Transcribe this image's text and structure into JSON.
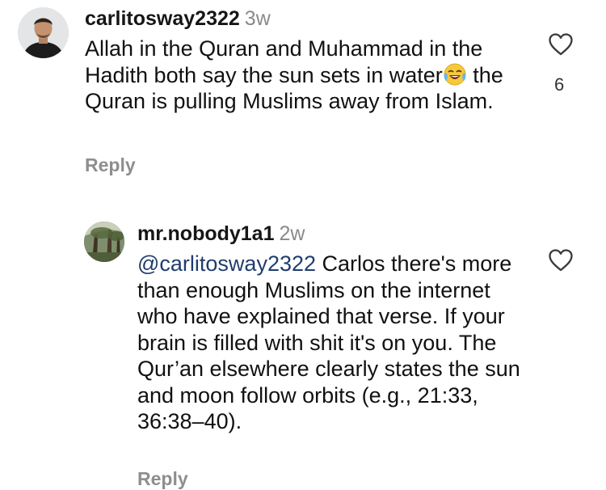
{
  "comments": [
    {
      "username": "carlitosway2322",
      "time": "3w",
      "text_part1": "Allah in the Quran and Muhammad in the Hadith both say the sun sets in water",
      "emoji": "face-with-tears-of-joy",
      "text_part2": " the Quran is pulling Muslims away from Islam.",
      "reply_label": "Reply",
      "like_count": "6",
      "like_icon": "heart-outline-icon"
    },
    {
      "username": "mr.nobody1a1",
      "time": "2w",
      "mention": "@carlitosway2322",
      "text": " Carlos there's more than enough Muslims on the internet who have explained that verse. If your brain is filled with shit it's on you. The Qur’an elsewhere clearly states the sun and moon follow orbits (e.g., 21:33, 36:38–40).",
      "reply_label": "Reply",
      "like_icon": "heart-outline-icon"
    }
  ],
  "colors": {
    "username": "#161616",
    "timestamp": "#8a8a8a",
    "reply": "#8e8e8e",
    "mention": "#1f3d6e"
  }
}
